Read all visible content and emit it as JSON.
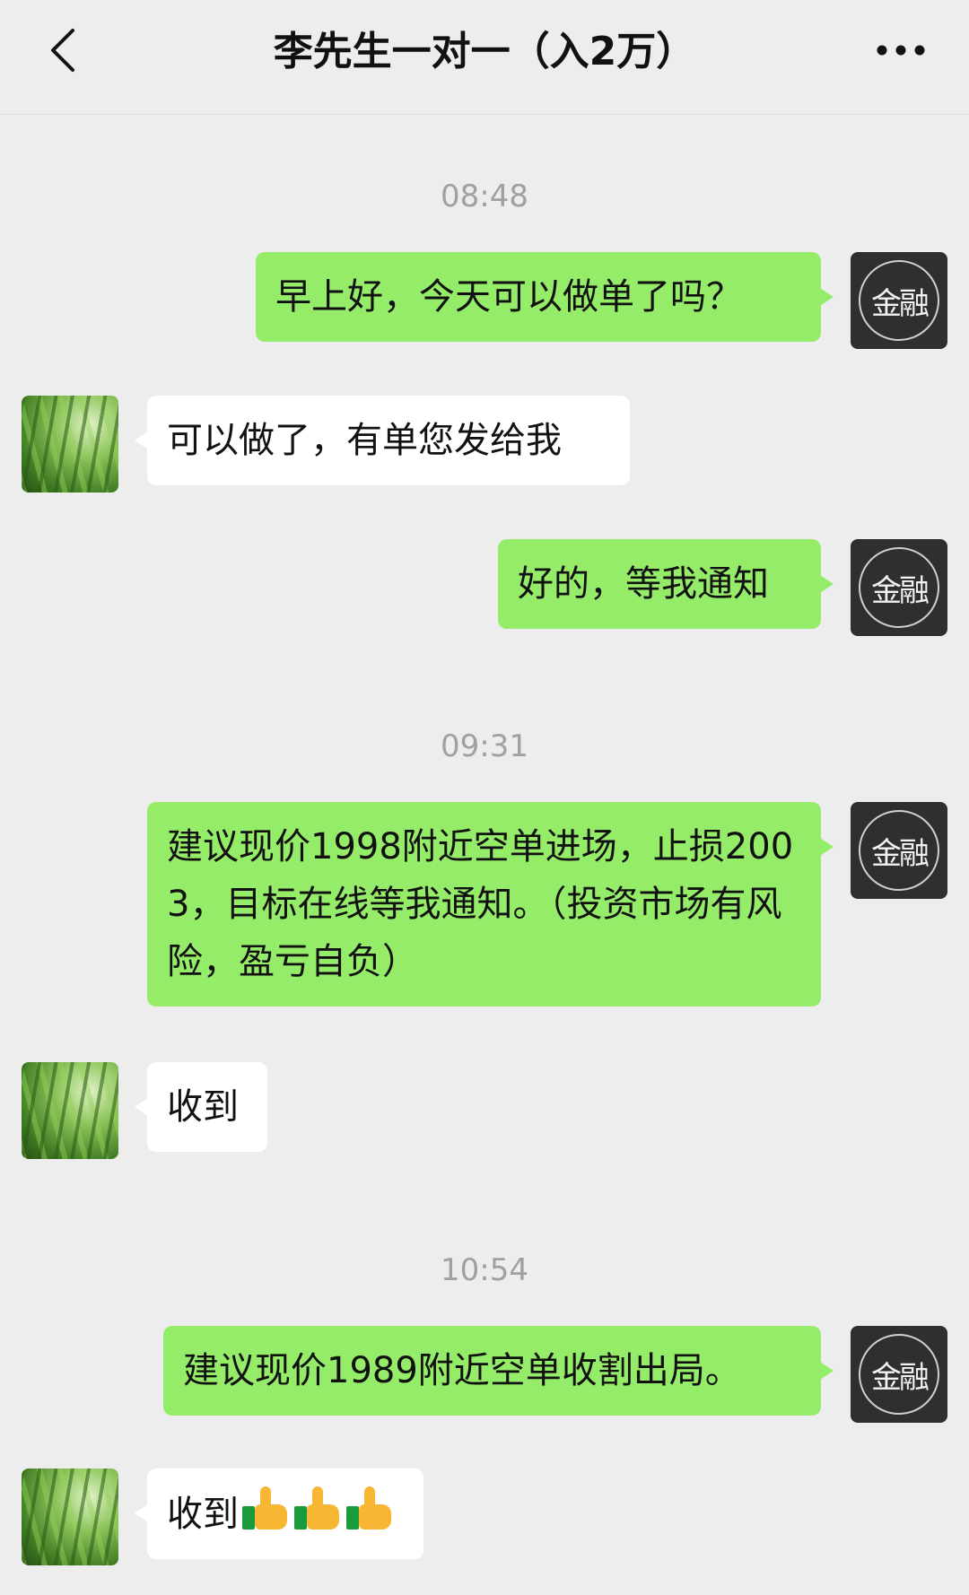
{
  "header": {
    "title": "李先生一对一（入2万）"
  },
  "messages": [
    {
      "type": "time",
      "text": "08:48"
    },
    {
      "type": "msg",
      "from": "self",
      "text": "早上好，今天可以做单了吗？"
    },
    {
      "type": "msg",
      "from": "other",
      "text": "可以做了，有单您发给我"
    },
    {
      "type": "msg",
      "from": "self",
      "text": "好的，等我通知"
    },
    {
      "type": "time",
      "text": "09:31"
    },
    {
      "type": "msg",
      "from": "self",
      "text": "建议现价1998附近空单进场，止损2003，目标在线等我通知。（投资市场有风险，盈亏自负）"
    },
    {
      "type": "msg",
      "from": "other",
      "text": "收到"
    },
    {
      "type": "time",
      "text": "10:54"
    },
    {
      "type": "msg",
      "from": "self",
      "text": "建议现价1989附近空单收割出局。"
    },
    {
      "type": "msg",
      "from": "other",
      "text": "收到",
      "emoji": [
        "thumbs-up-icon",
        "thumbs-up-icon",
        "thumbs-up-icon"
      ]
    }
  ],
  "avatars": {
    "self": {
      "text": "金融",
      "ring_color": "#cfcfcf",
      "bg": "#2f2f2f",
      "accent": "#e8c33c"
    },
    "other": {
      "image": "bamboo"
    }
  },
  "colors": {
    "background": "#ededed",
    "self_bubble": "#95ec69",
    "other_bubble": "#ffffff",
    "time_text": "#a0a0a0"
  }
}
